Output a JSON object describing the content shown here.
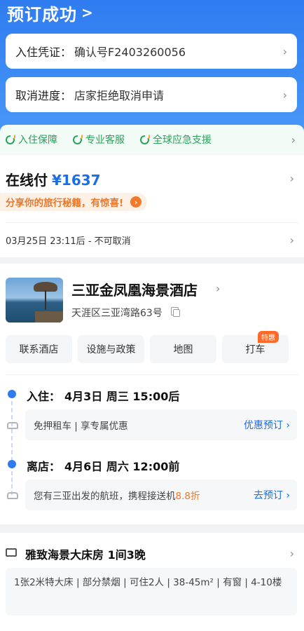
{
  "header": {
    "title": "预订成功",
    "title_chevron": ">",
    "voucher_label": "入住凭证：",
    "voucher_value": "确认号F2403260056",
    "cancel_label": "取消进度：",
    "cancel_value": "店家拒绝取消申请"
  },
  "guarantees": [
    "入住保障",
    "专业客服",
    "全球应急支援"
  ],
  "payment": {
    "method": "在线付",
    "amount": "¥1637",
    "share_text": "分享你的旅行秘籍，有惊喜!",
    "share_arrow": "›",
    "cancel_policy": "03月25日 23:11后 - 不可取消"
  },
  "hotel": {
    "name": "三亚金凤凰海景酒店",
    "address": "天涯区三亚湾路63号",
    "actions": [
      "联系酒店",
      "设施与政策",
      "地图",
      "打车"
    ],
    "taxi_tag": "特惠",
    "checkin_label": "入住：",
    "checkin_value": "4月3日 周三 15:00后",
    "car_text": "免押租车 | 享专属优惠",
    "car_action": "优惠预订",
    "checkout_label": "离店：",
    "checkout_value": "4月6日 周六 12:00前",
    "flight_text_1": "您有三亚出发的航班，携程接送机",
    "flight_discount": "8.8折",
    "flight_action": "去预订"
  },
  "room": {
    "title": "雅致海景大床房  1间3晚",
    "details": "1张2米特大床 | 部分禁烟 | 可住2人 | 38-45m² | 有窗 | 4-10楼"
  },
  "colors": {
    "primary": "#2f7cf0",
    "link": "#1a6ee8",
    "green": "#27a35a",
    "orange": "#f07a2c"
  }
}
